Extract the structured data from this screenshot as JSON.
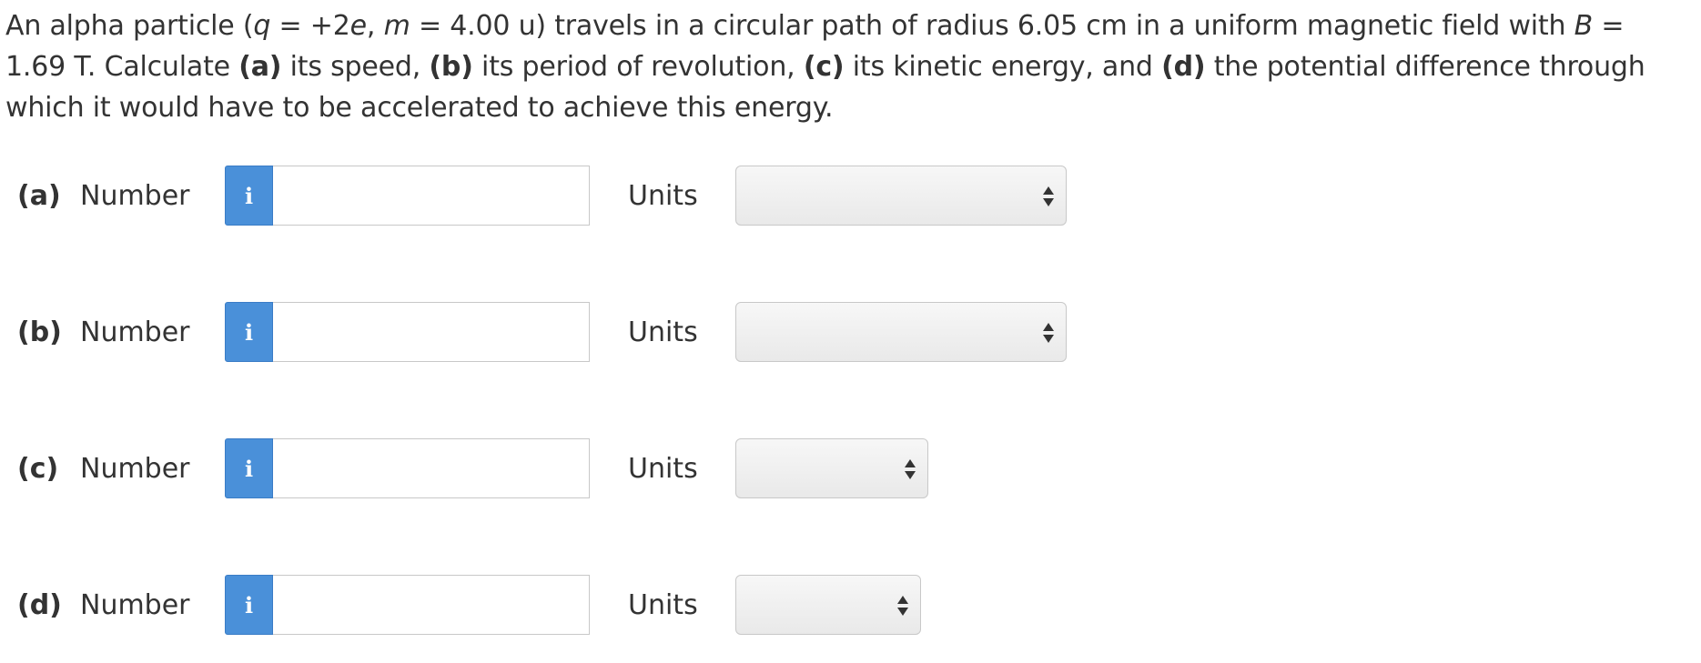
{
  "question": {
    "text_1": "An alpha particle (",
    "q_var": "q",
    "text_2": " = +2",
    "e_var": "e",
    "text_3": ", ",
    "m_var": "m",
    "text_4": " = 4.00 u) travels in a circular path of radius 6.05 cm in a uniform magnetic field with ",
    "b_var": "B",
    "text_5": " = 1.69 T. Calculate ",
    "part_a": "(a)",
    "text_6": " its speed, ",
    "part_b": "(b)",
    "text_7": " its period of revolution, ",
    "part_c": "(c)",
    "text_8": " its kinetic energy, and ",
    "part_d": "(d)",
    "text_9": " the potential difference through which it would have to be accelerated to achieve this energy."
  },
  "rows": [
    {
      "part": "(a)",
      "number_label": "Number",
      "info_glyph": "i",
      "value": "",
      "units_label": "Units",
      "units_selected": ""
    },
    {
      "part": "(b)",
      "number_label": "Number",
      "info_glyph": "i",
      "value": "",
      "units_label": "Units",
      "units_selected": ""
    },
    {
      "part": "(c)",
      "number_label": "Number",
      "info_glyph": "i",
      "value": "",
      "units_label": "Units",
      "units_selected": ""
    },
    {
      "part": "(d)",
      "number_label": "Number",
      "info_glyph": "i",
      "value": "",
      "units_label": "Units",
      "units_selected": ""
    }
  ],
  "colors": {
    "info_button": "#4a90d9",
    "text": "#333333",
    "border": "#c8c8c8"
  },
  "icons": {
    "info": "info-icon",
    "select_arrows": "up-down-arrows-icon"
  }
}
